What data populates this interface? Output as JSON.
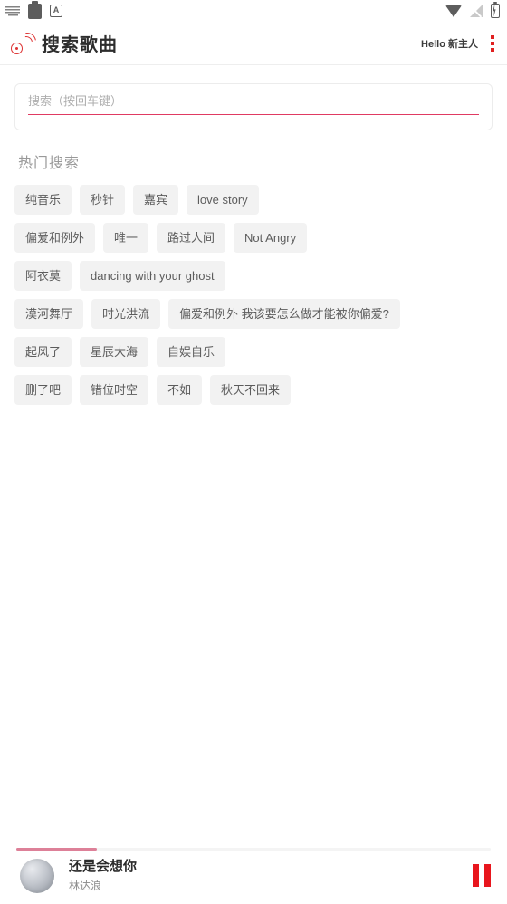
{
  "status_bar": {
    "left_icons": [
      "keyboard-icon",
      "clipboard-icon",
      "a-badge-icon"
    ],
    "right_icons": [
      "wifi-icon",
      "signal-off-icon",
      "battery-charging-icon"
    ],
    "a_badge_label": "A"
  },
  "header": {
    "logo_icon": "music-wave-icon",
    "title": "搜索歌曲",
    "greeting": "Hello 新主人",
    "menu_icon": "kebab-menu-icon",
    "accent_color": "#e02020"
  },
  "search": {
    "value": "",
    "placeholder": "搜索（按回车键）",
    "underline_color": "#e03a62"
  },
  "hot_searches": {
    "title": "热门搜索",
    "rows": [
      [
        "纯音乐",
        "秒针",
        "嘉宾",
        "love story"
      ],
      [
        "偏爱和例外",
        "唯一",
        "路过人间",
        "Not Angry"
      ],
      [
        "阿衣莫",
        "dancing with your ghost"
      ],
      [
        "漠河舞厅",
        "时光洪流",
        "偏爱和例外 我该要怎么做才能被你偏爱?"
      ],
      [
        "起风了",
        "星辰大海",
        "自娱自乐"
      ],
      [
        "删了吧",
        "错位时空",
        "不如",
        "秋天不回来"
      ]
    ]
  },
  "player": {
    "progress_percent": "17%",
    "progress_fill_color": "#dd8098",
    "album_art": "album-art-placeholder",
    "track_title": "还是会想你",
    "track_artist": "林达浪",
    "control_icon": "pause-icon",
    "control_color": "#e8161d"
  }
}
